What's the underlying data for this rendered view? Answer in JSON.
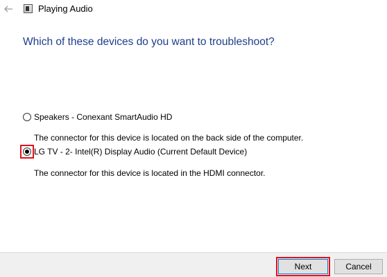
{
  "window": {
    "title": "Playing Audio",
    "icons": {
      "back": "back-arrow-icon",
      "app": "audio-troubleshooter-icon"
    }
  },
  "main": {
    "heading": "Which of these devices do you want to troubleshoot?",
    "options": [
      {
        "label": "Speakers - Conexant SmartAudio HD",
        "description": "The connector for this device is located on the back side of the computer.",
        "selected": false
      },
      {
        "label": "LG TV - 2- Intel(R) Display Audio (Current Default Device)",
        "description": "The connector for this device is located in the HDMI connector.",
        "selected": true
      }
    ]
  },
  "footer": {
    "next_label": "Next",
    "cancel_label": "Cancel"
  },
  "colors": {
    "heading": "#1e3d8a",
    "highlight": "#e0101b",
    "footer_bg": "#f0f0f0"
  }
}
